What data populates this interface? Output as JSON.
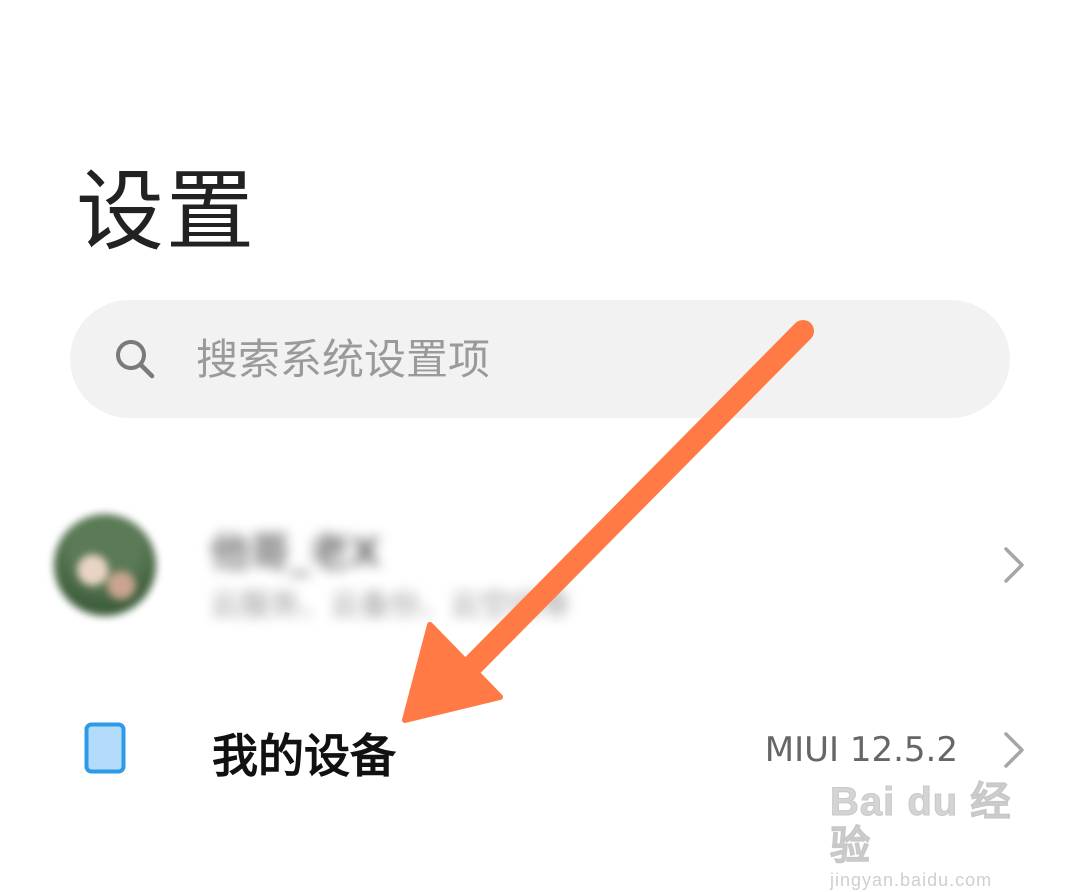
{
  "header": {
    "title": "设置"
  },
  "search": {
    "placeholder": "搜索系统设置项",
    "icon": "search-icon"
  },
  "account": {
    "name": "他哥_老X",
    "description": "云服务、云备份、云空间等",
    "chevron_icon": "chevron-right-icon"
  },
  "my_device": {
    "label": "我的设备",
    "value": "MIUI 12.5.2",
    "icon": "tablet-icon",
    "icon_color": "#a8d8f8",
    "icon_border": "#2e9be8",
    "chevron_icon": "chevron-right-icon"
  },
  "overlay": {
    "arrow_color": "#ff7a45"
  },
  "watermark": {
    "brand": "Bai du 经验",
    "url": "jingyan.baidu.com"
  }
}
